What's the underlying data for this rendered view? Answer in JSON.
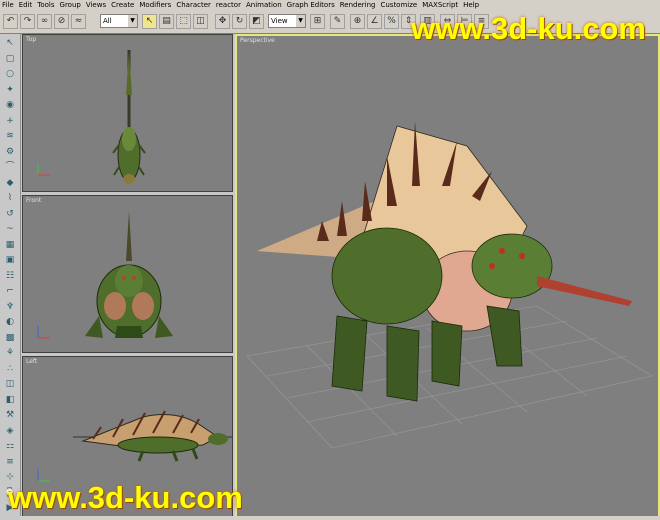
{
  "menu": [
    "File",
    "Edit",
    "Tools",
    "Group",
    "Views",
    "Create",
    "Modifiers",
    "Character",
    "reactor",
    "Animation",
    "Graph Editors",
    "Rendering",
    "Customize",
    "MAXScript",
    "Help"
  ],
  "toolbar": {
    "selection_filter": "All",
    "reference_coord": "View",
    "tool_icons": [
      "undo-icon",
      "redo-icon",
      "link-icon",
      "unlink-icon",
      "bind-icon",
      "select-filter",
      "select-icon",
      "select-by-name-icon",
      "region-select-icon",
      "move-icon",
      "rotate-icon",
      "scale-icon",
      "reference-coord",
      "pivot-icon",
      "manipulate-icon",
      "snap-icon",
      "angle-snap-icon",
      "percent-snap-icon",
      "spinner-snap-icon",
      "named-selection-icon",
      "mirror-icon",
      "align-icon",
      "layer-icon",
      "curve-editor-icon",
      "schematic-icon",
      "material-editor-icon",
      "render-setup-icon",
      "quick-render-icon"
    ]
  },
  "left_toolbar_icons": [
    "select-icon",
    "box-icon",
    "sphere-icon",
    "light-icon",
    "camera-icon",
    "helper-icon",
    "space-warp-icon",
    "system-icon",
    "shape-icon",
    "modifier-icon",
    "bend-icon",
    "twist-icon",
    "noise-icon",
    "ffd-icon",
    "uvw-icon",
    "skin-icon",
    "bone-icon",
    "biped-icon",
    "morph-icon",
    "cloth-icon",
    "hair-icon",
    "particle-icon",
    "render-icon",
    "display-icon",
    "utility-icon",
    "motion-icon",
    "hierarchy-icon",
    "layer-icon",
    "track-icon",
    "key-icon",
    "time-icon"
  ],
  "viewports": {
    "top": "Top",
    "front": "Front",
    "left": "Left",
    "perspective": "Perspective"
  },
  "watermark": {
    "top": "www.3d-ku.com",
    "bottom": "www.3d-ku.com"
  }
}
